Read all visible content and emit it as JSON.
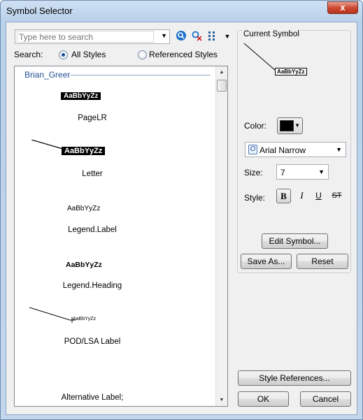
{
  "window": {
    "title": "Symbol Selector",
    "close_glyph": "x"
  },
  "search": {
    "placeholder": "Type here to search"
  },
  "toolbar": {
    "search_icon": "search-icon",
    "clear_icon": "clear-search-icon",
    "view_icon": "grid-view-icon"
  },
  "filter": {
    "label": "Search:",
    "all_styles": "All Styles",
    "referenced_styles": "Referenced Styles",
    "selected": "All Styles"
  },
  "list": {
    "group": "Brian_Greer",
    "items": [
      {
        "name": "PageLR",
        "sample": "AaBbYyZz"
      },
      {
        "name": "Letter",
        "sample": "AaBbYyZz"
      },
      {
        "name": "Legend.Label",
        "sample": "AaBbYyZz"
      },
      {
        "name": "Legend.Heading",
        "sample": "AaBbYyZz"
      },
      {
        "name": "POD/LSA Label",
        "sample": "AaBbYyZz"
      },
      {
        "name": "Alternative Label;",
        "sample": ""
      }
    ]
  },
  "current_symbol": {
    "label": "Current Symbol",
    "preview_text": "AaBbYyZz",
    "color_label": "Color:",
    "color_value": "#000000",
    "font_value": "Arial Narrow",
    "size_label": "Size:",
    "size_value": "7",
    "style_label": "Style:",
    "style_buttons": {
      "bold": "B",
      "italic": "I",
      "underline": "U",
      "strikethrough": "ST"
    }
  },
  "buttons": {
    "edit_symbol": "Edit Symbol...",
    "save_as": "Save As...",
    "reset": "Reset",
    "style_references": "Style References...",
    "ok": "OK",
    "cancel": "Cancel"
  }
}
